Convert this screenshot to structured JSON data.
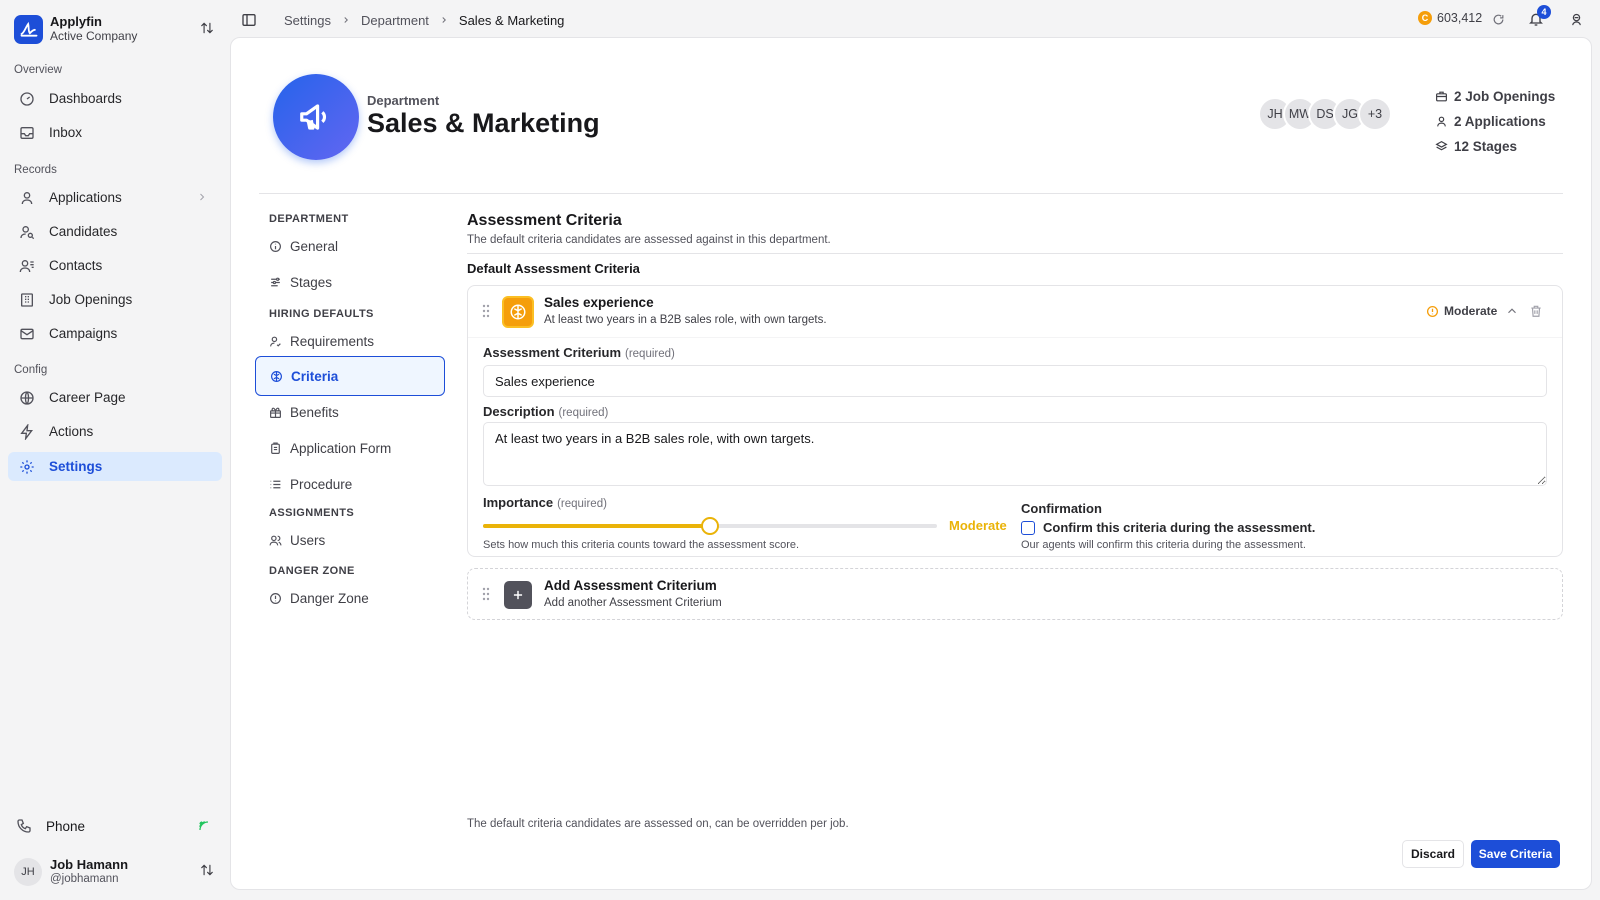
{
  "app": {
    "name": "Applyfin",
    "company": "Active Company"
  },
  "sidebar": {
    "groups": [
      {
        "label": "Overview"
      },
      {
        "label": "Records"
      },
      {
        "label": "Config"
      }
    ],
    "items": [
      {
        "label": "Dashboards",
        "icon": "gauge-icon"
      },
      {
        "label": "Inbox",
        "icon": "inbox-icon"
      },
      {
        "label": "Applications",
        "icon": "user-icon"
      },
      {
        "label": "Candidates",
        "icon": "user-search-icon"
      },
      {
        "label": "Contacts",
        "icon": "contacts-icon"
      },
      {
        "label": "Job Openings",
        "icon": "building-icon"
      },
      {
        "label": "Campaigns",
        "icon": "mail-icon"
      },
      {
        "label": "Career Page",
        "icon": "globe-icon"
      },
      {
        "label": "Actions",
        "icon": "zap-icon"
      },
      {
        "label": "Settings",
        "icon": "gear-icon",
        "active": true
      }
    ],
    "phone": "Phone",
    "user": {
      "initials": "JH",
      "name": "Job Hamann",
      "handle": "@jobhamann"
    }
  },
  "topbar": {
    "breadcrumb": [
      "Settings",
      "Department",
      "Sales & Marketing"
    ],
    "credits": "603,412",
    "coin_symbol": "C",
    "notifications": "4"
  },
  "header": {
    "kicker": "Department",
    "title": "Sales & Marketing",
    "avatars": [
      "JH",
      "MW",
      "DS",
      "JG",
      "+3"
    ],
    "stats": [
      {
        "label": "2 Job Openings",
        "icon": "briefcase-icon"
      },
      {
        "label": "2 Applications",
        "icon": "user-icon"
      },
      {
        "label": "12 Stages",
        "icon": "layers-icon"
      }
    ]
  },
  "settings_nav": {
    "groups": [
      "DEPARTMENT",
      "HIRING DEFAULTS",
      "ASSIGNMENTS",
      "DANGER ZONE"
    ],
    "items": [
      {
        "label": "General",
        "icon": "info-icon"
      },
      {
        "label": "Stages",
        "icon": "sliders-icon"
      },
      {
        "label": "Requirements",
        "icon": "user-check-icon"
      },
      {
        "label": "Criteria",
        "icon": "brain-icon",
        "active": true
      },
      {
        "label": "Benefits",
        "icon": "gift-icon"
      },
      {
        "label": "Application Form",
        "icon": "clipboard-icon"
      },
      {
        "label": "Procedure",
        "icon": "list-icon"
      },
      {
        "label": "Users",
        "icon": "users-icon"
      },
      {
        "label": "Danger Zone",
        "icon": "alert-circle-icon"
      }
    ]
  },
  "content": {
    "title": "Assessment Criteria",
    "description": "The default criteria candidates are assessed against in this department.",
    "subtitle": "Default Assessment Criteria",
    "criterion": {
      "name": "Sales experience",
      "summary": "At least two years in a B2B sales role, with own targets.",
      "importance_label": "Moderate",
      "field_criterion_label": "Assessment Criterium",
      "field_description_label": "Description",
      "required": "(required)",
      "criterion_value": "Sales experience",
      "description_value": "At least two years in a B2B sales role, with own targets.",
      "importance_field_label": "Importance",
      "importance_value": "Moderate",
      "importance_level": 0.5,
      "importance_help": "Sets how much this criteria counts toward the assessment score.",
      "confirmation_label": "Confirmation",
      "confirmation_text": "Confirm this criteria during the assessment.",
      "confirmation_help": "Our agents will confirm this criteria during the assessment.",
      "confirmed": false
    },
    "add": {
      "title": "Add Assessment Criterium",
      "subtitle": "Add another Assessment Criterium"
    },
    "footer_note": "The default criteria candidates are assessed on, can be overridden per job.",
    "discard_label": "Discard",
    "save_label": "Save Criteria"
  },
  "colors": {
    "accent": "#1d4ed8",
    "importance": "#eab308"
  }
}
